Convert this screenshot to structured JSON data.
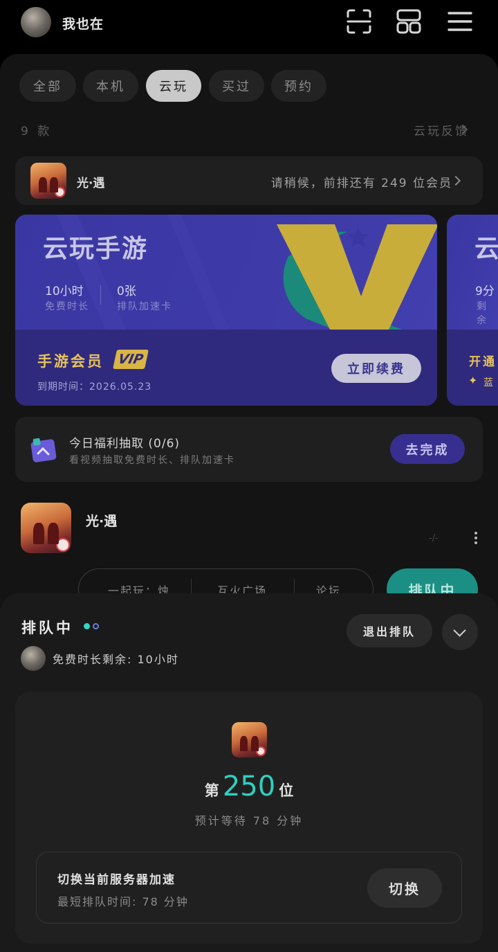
{
  "header": {
    "username": "我也在"
  },
  "icons": {
    "scan": "scan-icon",
    "grid": "grid-icon",
    "menu": "menu-icon"
  },
  "tabs": [
    {
      "label": "全部",
      "active": false
    },
    {
      "label": "本机",
      "active": false
    },
    {
      "label": "云玩",
      "active": true
    },
    {
      "label": "买过",
      "active": false
    },
    {
      "label": "预约",
      "active": false
    }
  ],
  "list_header": {
    "count": "9 款",
    "feedback": "云玩反馈"
  },
  "queue_banner": {
    "game": "光·遇",
    "message": "请稍候，前排还有 249 位会员"
  },
  "promo_card": {
    "title": "云玩手游",
    "free_time_value": "10小时",
    "free_time_label": "免费时长",
    "speed_card_value": "0张",
    "speed_card_label": "排队加速卡",
    "member_title": "手游会员",
    "vip_badge": "VIP",
    "expiry": "到期时间：2026.05.23",
    "renew_button": "立即续费"
  },
  "promo_card_2": {
    "title": "云",
    "stat_value": "9分",
    "stat_label": "剩余",
    "member_title": "开通",
    "sub_label": "蓝"
  },
  "daily": {
    "title": "今日福利抽取 (0/6)",
    "subtitle": "看视频抽取免费时长、排队加速卡",
    "button": "去完成"
  },
  "game": {
    "name": "光·遇",
    "dash": "-/-",
    "chips": [
      "一起玩：烛",
      "互火广场",
      "论坛"
    ],
    "queue_button": "排队中"
  },
  "sheet": {
    "title": "排队中",
    "exit_button": "退出排队",
    "remaining": "免费时长剩余: 10小时",
    "position_prefix": "第",
    "position": "250",
    "position_suffix": "位",
    "eta": "预计等待 78 分钟",
    "server_title": "切换当前服务器加速",
    "server_sub": "最短排队时间: 78 分钟",
    "switch_button": "切换"
  },
  "colors": {
    "accent": "#2fd0bf",
    "card": "#3a37a3",
    "vip": "#d8b545"
  }
}
